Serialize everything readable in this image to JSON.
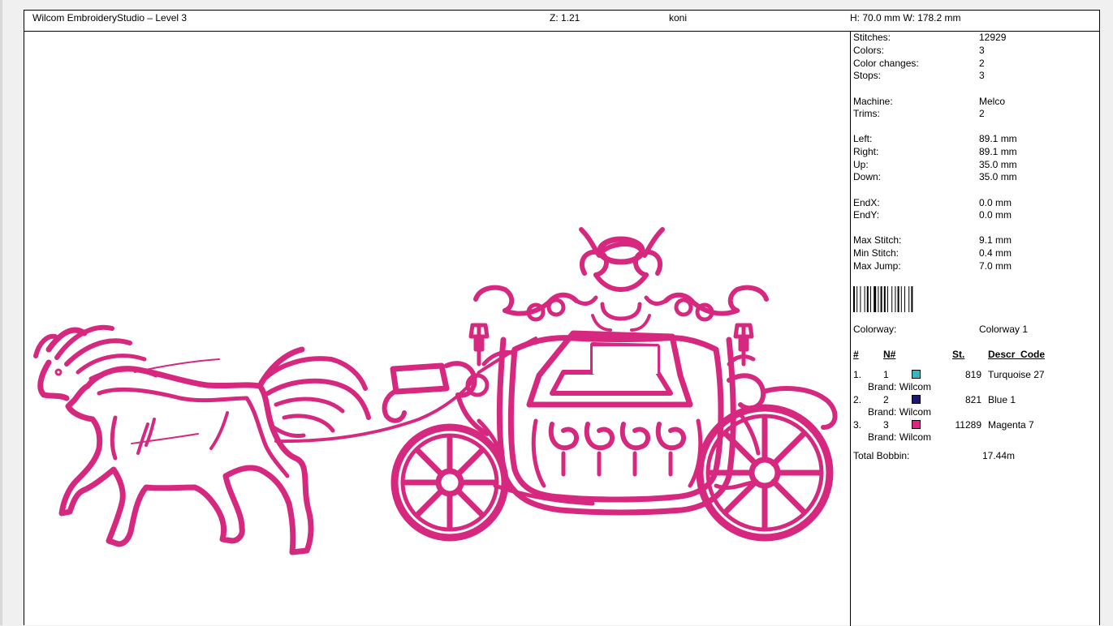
{
  "header": {
    "title": "Wilcom EmbroideryStudio – Level 3",
    "zoom": "Z: 1.21",
    "design_name": "koni",
    "dimensions": "H: 70.0 mm   W: 178.2 mm"
  },
  "info": {
    "stitches_label": "Stitches:",
    "stitches": "12929",
    "colors_label": "Colors:",
    "colors": "3",
    "color_changes_label": "Color changes:",
    "color_changes": "2",
    "stops_label": "Stops:",
    "stops": "3",
    "machine_label": "Machine:",
    "machine": "Melco",
    "trims_label": "Trims:",
    "trims": "2",
    "left_label": "Left:",
    "left": "89.1 mm",
    "right_label": "Right:",
    "right": "89.1 mm",
    "up_label": "Up:",
    "up": "35.0 mm",
    "down_label": "Down:",
    "down": "35.0 mm",
    "endx_label": "EndX:",
    "endx": "0.0 mm",
    "endy_label": "EndY:",
    "endy": "0.0 mm",
    "max_stitch_label": "Max Stitch:",
    "max_stitch": "9.1 mm",
    "min_stitch_label": "Min Stitch:",
    "min_stitch": "0.4 mm",
    "max_jump_label": "Max Jump:",
    "max_jump": "7.0 mm",
    "colorway_label": "Colorway:",
    "colorway": "Colorway 1"
  },
  "table": {
    "headers": {
      "index": "#",
      "needle": "N#",
      "stitches": "St.",
      "descr": "Descr_Code"
    },
    "rows": [
      {
        "index": "1.",
        "needle": "1",
        "color": "#3ab5c0",
        "stitches": "819",
        "descr": "Turquoise 27",
        "brand": "Brand: Wilcom"
      },
      {
        "index": "2.",
        "needle": "2",
        "color": "#1c1870",
        "stitches": "821",
        "descr": "Blue 1",
        "brand": "Brand: Wilcom"
      },
      {
        "index": "3.",
        "needle": "3",
        "color": "#e0257f",
        "stitches": "11289",
        "descr": "Magenta 7",
        "brand": "Brand: Wilcom"
      }
    ],
    "total_bobbin_label": "Total Bobbin:",
    "total_bobbin": "17.44m"
  },
  "design": {
    "thread_color": "#d6287e"
  }
}
